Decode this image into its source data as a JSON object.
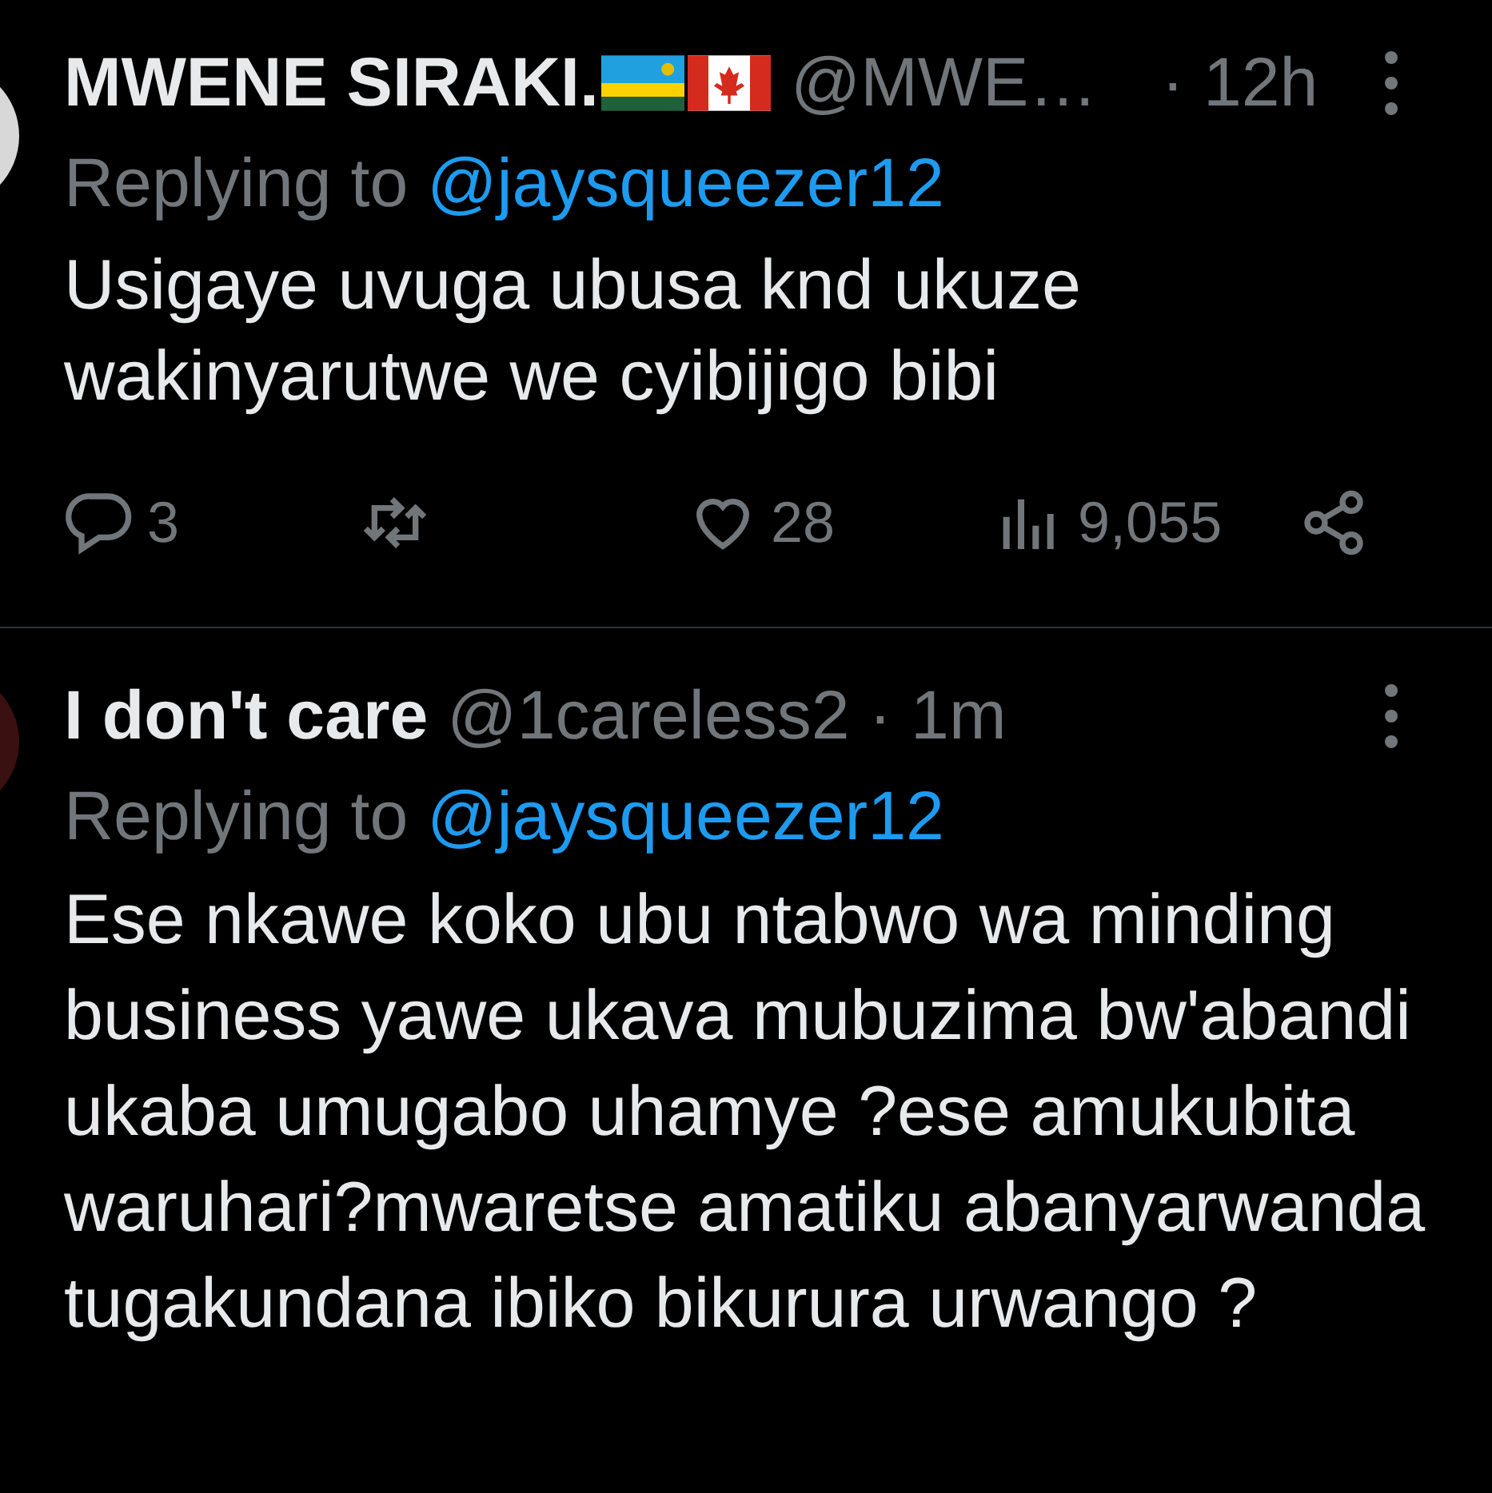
{
  "tweets": [
    {
      "name": "MWENE SIRAKI.",
      "flag_emoji": [
        {
          "kind": "rwanda"
        },
        {
          "kind": "canada"
        }
      ],
      "handle": "@MWE…",
      "time": "· 12h",
      "replying_label": "Replying to",
      "replying_to": "@jaysqueezer12",
      "text": "Usigaye uvuga ubusa knd ukuze wakinyarutwe we cyibijigo bibi",
      "stats": {
        "replies": "3",
        "likes": "28",
        "views": "9,055"
      }
    },
    {
      "name": "I don't care",
      "handle": "@1careless2",
      "time": "· 1m",
      "replying_label": "Replying to",
      "replying_to": "@jaysqueezer12",
      "text": "Ese nkawe koko ubu ntabwo wa minding business yawe ukava mubuzima bw'abandi ukaba umugabo uhamye ?ese amukubita waruhari?mwaretse amatiku abanyarwanda tugakundana ibiko bikurura urwango ?"
    }
  ]
}
